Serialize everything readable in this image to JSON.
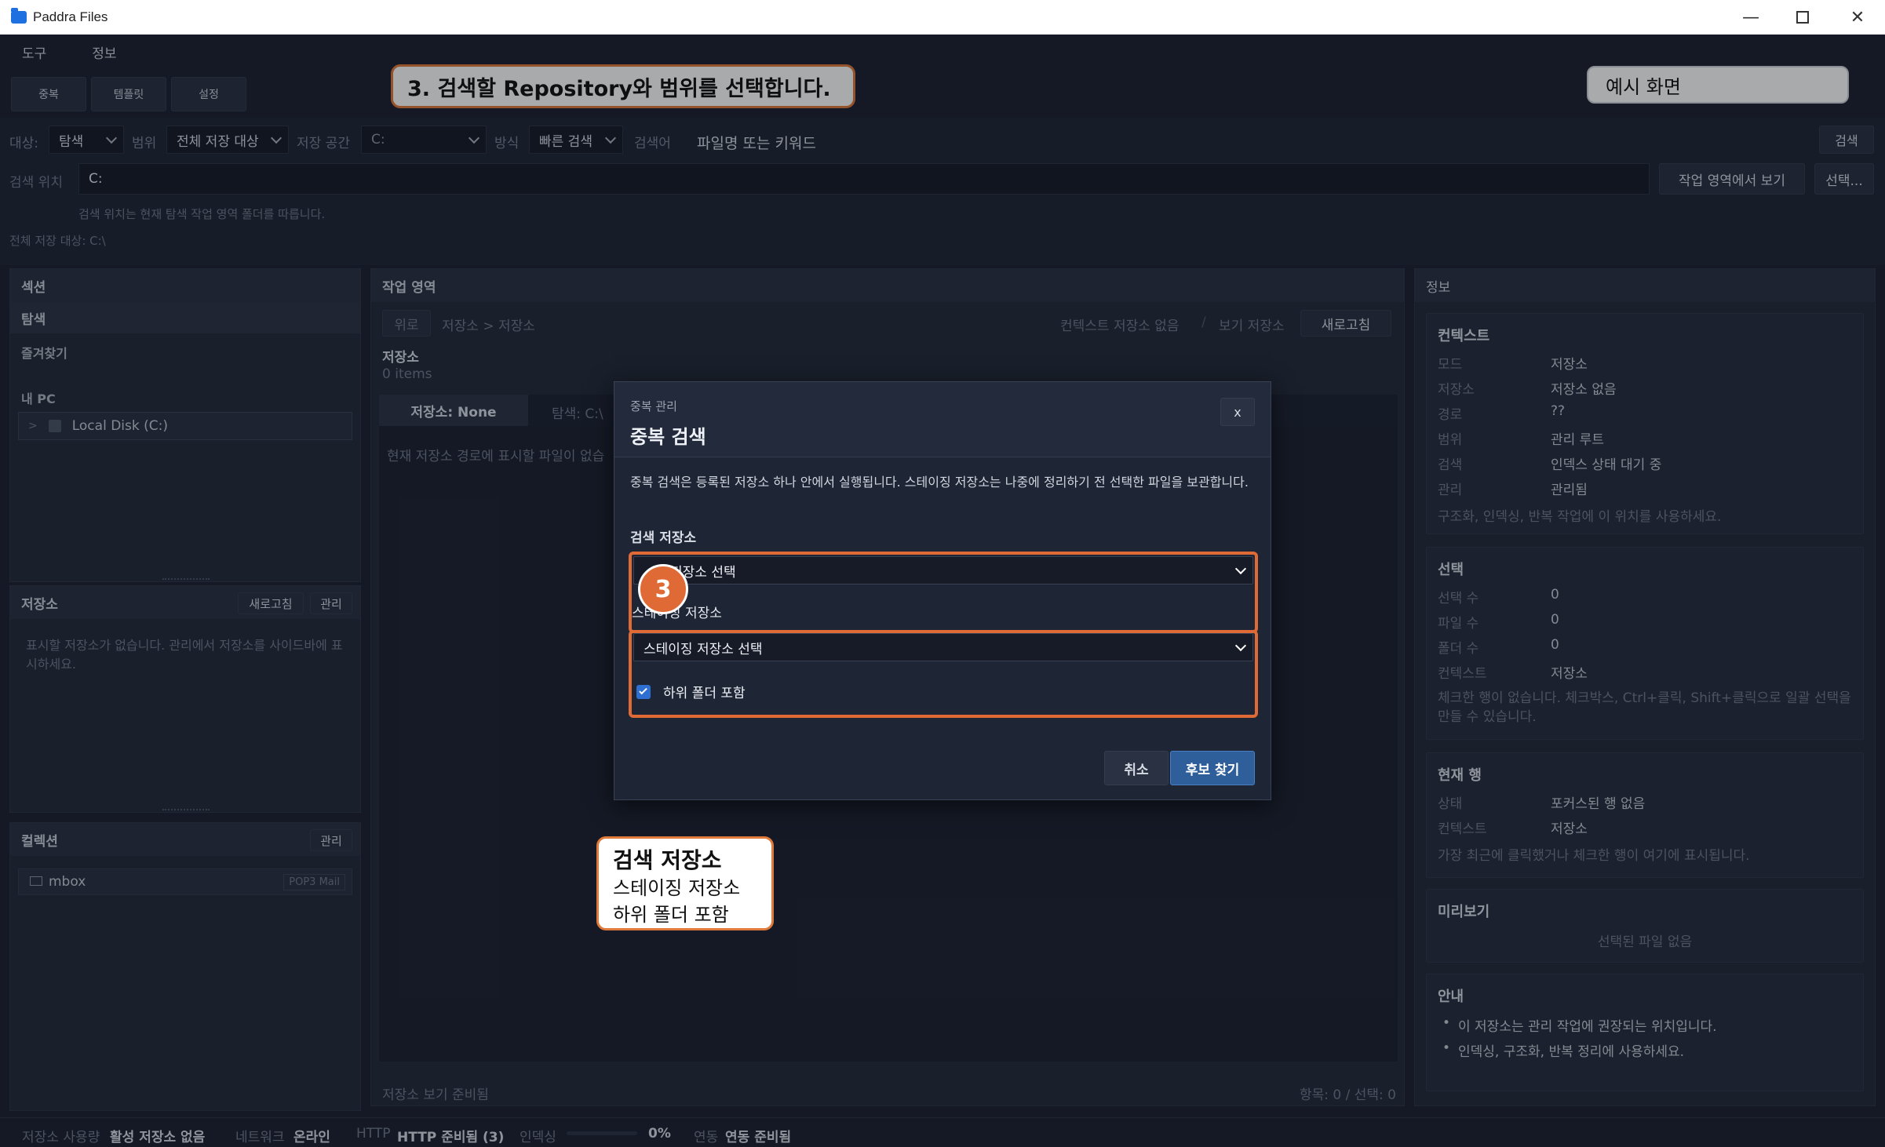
{
  "window": {
    "title": "Paddra Files"
  },
  "menu": [
    "도구",
    "정보"
  ],
  "toolbar": {
    "buttons": [
      "중복",
      "템플릿",
      "설정"
    ]
  },
  "tutorial": {
    "step_banner": "3. 검색할 Repository와 범위를 선택합니다.",
    "example_badge": "예시 화면",
    "step_number": "3",
    "callout_title": "검색 저장소",
    "callout_lines": [
      "스테이징 저장소",
      "하위 폴더 포함"
    ]
  },
  "filters": {
    "target_label": "대상:",
    "target_value": "탐색",
    "scope_label": "범위",
    "scope_value": "전체 저장 대상",
    "storage_label": "저장 공간",
    "storage_value": "C:",
    "mode_label": "방식",
    "mode_value": "빠른 검색",
    "keyword_label": "검색어",
    "keyword_placeholder": "파일명 또는 키워드",
    "search_button": "검색"
  },
  "location": {
    "label": "검색 위치",
    "value": "C:",
    "view_button": "작업 영역에서 보기",
    "select_button": "선택...",
    "hint": "검색 위치는 현재 탐색 작업 영역 폴더를 따릅니다.",
    "all_targets": "전체 저장 대상: C:\\"
  },
  "sections": {
    "title": "섹션",
    "items": [
      "탐색",
      "즐겨찾기"
    ],
    "mypc_label": "내 PC",
    "disk_label": "Local Disk (C:)"
  },
  "repositories": {
    "title": "저장소",
    "refresh": "새로고침",
    "manage": "관리",
    "empty_text": "표시할 저장소가 없습니다. 관리에서 저장소를 사이드바에 표시하세요."
  },
  "collections": {
    "title": "컬렉션",
    "manage": "관리",
    "items": [
      {
        "name": "mbox",
        "tag": "POP3 Mail"
      }
    ]
  },
  "workspace": {
    "title": "작업 영역",
    "up_button": "위로",
    "breadcrumb": "저장소 > 저장소",
    "context_info": "컨텍스트 저장소 없음",
    "separator": "/",
    "view_info": "보기 저장소",
    "refresh": "새로고침",
    "folder_name": "저장소",
    "item_count": "0 items",
    "tabs": [
      "저장소: None",
      "탐색: C:\\"
    ],
    "empty_text": "현재 저장소 경로에 표시할 파일이 없습",
    "footer_left": "저장소 보기 준비됨",
    "footer_right": "항목: 0 / 선택: 0"
  },
  "info": {
    "title": "정보",
    "context": {
      "title": "컨텍스트",
      "rows": [
        {
          "k": "모드",
          "v": "저장소"
        },
        {
          "k": "저장소",
          "v": "저장소 없음"
        },
        {
          "k": "경로",
          "v": "??"
        },
        {
          "k": "범위",
          "v": "관리 루트"
        },
        {
          "k": "검색",
          "v": "인덱스 상태 대기 중"
        },
        {
          "k": "관리",
          "v": "관리됨"
        }
      ],
      "note": "구조화, 인덱싱, 반복 작업에 이 위치를 사용하세요."
    },
    "selection": {
      "title": "선택",
      "rows": [
        {
          "k": "선택 수",
          "v": "0"
        },
        {
          "k": "파일 수",
          "v": "0"
        },
        {
          "k": "폴더 수",
          "v": "0"
        },
        {
          "k": "컨텍스트",
          "v": "저장소"
        }
      ],
      "note": "체크한 행이 없습니다. 체크박스, Ctrl+클릭, Shift+클릭으로 일괄 선택을 만들 수 있습니다."
    },
    "current_row": {
      "title": "현재 행",
      "rows": [
        {
          "k": "상태",
          "v": "포커스된 행 없음"
        },
        {
          "k": "컨텍스트",
          "v": "저장소"
        }
      ],
      "note": "가장 최근에 클릭했거나 체크한 행이 여기에 표시됩니다."
    },
    "preview": {
      "title": "미리보기",
      "empty": "선택된 파일 없음"
    },
    "guide": {
      "title": "안내",
      "items": [
        "이 저장소는 관리 작업에 권장되는 위치입니다.",
        "인덱싱, 구조화, 반복 정리에 사용하세요."
      ]
    }
  },
  "modal": {
    "eyebrow": "중복 관리",
    "title": "중복 검색",
    "close": "x",
    "description": "중복 검색은 등록된 저장소 하나 안에서 실행됩니다. 스테이징 저장소는 나중에 정리하기 전 선택한 파일을 보관합니다.",
    "search_repo_label": "검색 저장소",
    "search_repo_value": "저장소 선택",
    "staging_label": "스테이징 저장소",
    "staging_value": "스테이징 저장소 선택",
    "include_subfolders": "하위 폴더 포함",
    "include_subfolders_checked": true,
    "cancel": "취소",
    "submit": "후보 찾기"
  },
  "status": {
    "usage_label": "저장소 사용량",
    "usage_value": "활성 저장소 없음",
    "network_label": "네트워크",
    "network_value": "온라인",
    "http_label": "HTTP",
    "http_value": "HTTP 준비됨 (3)",
    "index_label": "인덱싱",
    "index_value": "0%",
    "index_progress": 0,
    "sync_label": "연동",
    "sync_value": "연동 준비됨"
  },
  "colors": {
    "accent": "#e06a35",
    "primary_button": "#2f5f9a",
    "background": "#1b2130"
  }
}
